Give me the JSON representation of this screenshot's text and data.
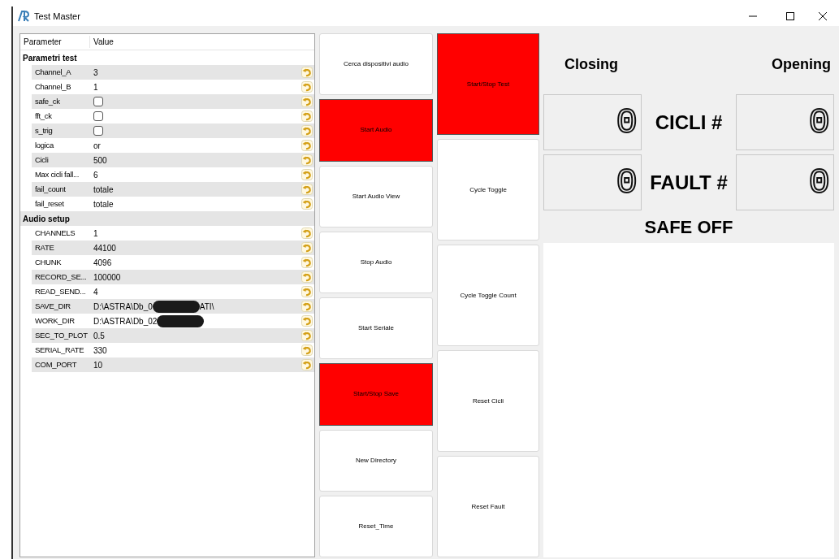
{
  "window": {
    "title": "Test Master"
  },
  "tree": {
    "columns": [
      "Parameter",
      "Value"
    ],
    "groups": [
      {
        "label": "Parametri test",
        "items": [
          {
            "name": "Channel_A",
            "kind": "text",
            "value": "3"
          },
          {
            "name": "Channel_B",
            "kind": "text",
            "value": "1"
          },
          {
            "name": "safe_ck",
            "kind": "checkbox",
            "checked": false
          },
          {
            "name": "fft_ck",
            "kind": "checkbox",
            "checked": false
          },
          {
            "name": "s_trig",
            "kind": "checkbox",
            "checked": false
          },
          {
            "name": "logica",
            "kind": "text",
            "value": "or"
          },
          {
            "name": "Cicli",
            "kind": "text",
            "value": "500"
          },
          {
            "name": "Max cicli fall...",
            "kind": "text",
            "value": "6"
          },
          {
            "name": "fail_count",
            "kind": "text",
            "value": "totale"
          },
          {
            "name": "fail_reset",
            "kind": "text",
            "value": "totale"
          }
        ]
      },
      {
        "label": "Audio setup",
        "items": [
          {
            "name": "CHANNELS",
            "kind": "text",
            "value": "1"
          },
          {
            "name": "RATE",
            "kind": "text",
            "value": "44100"
          },
          {
            "name": "CHUNK",
            "kind": "text",
            "value": "4096"
          },
          {
            "name": "RECORD_SE...",
            "kind": "text",
            "value": "100000"
          },
          {
            "name": "READ_SEND...",
            "kind": "text",
            "value": "4"
          },
          {
            "name": "SAVE_DIR",
            "kind": "redacted",
            "value": "D:\\ASTRA\\Db_0",
            "value_after": "ATI\\"
          },
          {
            "name": "WORK_DIR",
            "kind": "redacted",
            "value": "D:\\ASTRA\\Db_02"
          },
          {
            "name": "SEC_TO_PLOT",
            "kind": "text",
            "value": "0.5"
          },
          {
            "name": "SERIAL_RATE",
            "kind": "text",
            "value": "330"
          },
          {
            "name": "COM_PORT",
            "kind": "text",
            "value": "10"
          }
        ]
      }
    ]
  },
  "buttons_left": [
    {
      "label": "Cerca dispositivi audio",
      "on": false
    },
    {
      "label": "Start Audio",
      "on": true
    },
    {
      "label": "Start Audio View",
      "on": false
    },
    {
      "label": "Stop Audio",
      "on": false
    },
    {
      "label": "Start Seriale",
      "on": false
    },
    {
      "label": "Start/Stop Save",
      "on": true
    },
    {
      "label": "New Directory",
      "on": false
    },
    {
      "label": "Reset_Time",
      "on": false
    }
  ],
  "buttons_right": [
    {
      "label": "Start/Stop Test",
      "on": true
    },
    {
      "label": "Cycle Toggle",
      "on": false
    },
    {
      "label": "Cycle Toggle Count",
      "on": false
    },
    {
      "label": "Reset Cicli",
      "on": false
    },
    {
      "label": "Reset Fault",
      "on": false
    }
  ],
  "counters": {
    "closing_label": "Closing",
    "opening_label": "Opening",
    "rows": [
      {
        "label": "CICLI #",
        "closing": "0",
        "opening": "0"
      },
      {
        "label": "FAULT #",
        "closing": "0",
        "opening": "0"
      }
    ],
    "status": "SAFE OFF"
  }
}
